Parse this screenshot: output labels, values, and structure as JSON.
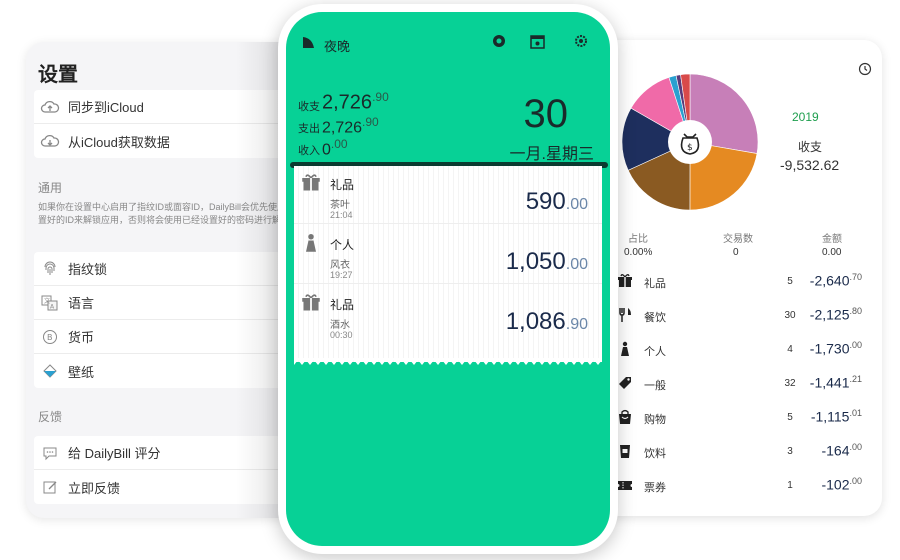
{
  "settings": {
    "title": "设置",
    "sync_items": [
      {
        "label": "同步到iCloud",
        "icon": "cloud-upload-icon"
      },
      {
        "label": "从iCloud获取数据",
        "icon": "cloud-download-icon"
      }
    ],
    "general_header": "通用",
    "general_note": "如果你在设置中心启用了指纹ID或面容ID，DailyBill会优先使用你设置好的ID来解锁应用，否则将会使用已经设置好的密码进行解锁",
    "general_items": [
      {
        "label": "指纹锁",
        "icon": "fingerprint-icon"
      },
      {
        "label": "语言",
        "icon": "language-icon"
      },
      {
        "label": "货币",
        "icon": "currency-icon"
      },
      {
        "label": "壁纸",
        "icon": "wallpaper-icon"
      }
    ],
    "feedback_header": "反馈",
    "feedback_items": [
      {
        "label": "给 DailyBill 评分",
        "icon": "rate-icon"
      },
      {
        "label": "立即反馈",
        "icon": "feedback-icon"
      }
    ]
  },
  "phone": {
    "mode_label": "夜晚",
    "summary": [
      {
        "label": "收支",
        "int": "2,726",
        "dec": ".90"
      },
      {
        "label": "支出",
        "int": "2,726",
        "dec": ".90"
      },
      {
        "label": "收入",
        "int": "0",
        "dec": ".00"
      }
    ],
    "day": "30",
    "date_label": "一月.星期三",
    "entries": [
      {
        "category": "礼品",
        "note": "茶叶",
        "time": "21:04",
        "amount_int": "590",
        "amount_dec": ".00",
        "icon": "gift-icon"
      },
      {
        "category": "个人",
        "note": "风衣",
        "time": "19:27",
        "amount_int": "1,050",
        "amount_dec": ".00",
        "icon": "person-icon"
      },
      {
        "category": "礼品",
        "note": "酒水",
        "time": "00:30",
        "amount_int": "1,086",
        "amount_dec": ".90",
        "icon": "gift-icon"
      }
    ]
  },
  "stats": {
    "year": "2019",
    "label": "收支",
    "value": "-9,532.62",
    "columns": [
      {
        "head": "占比",
        "value": "0.00%"
      },
      {
        "head": "交易数",
        "value": "0"
      },
      {
        "head": "金额",
        "value": "0.00"
      }
    ],
    "categories": [
      {
        "name": "礼品",
        "count": "5",
        "int": "-2,640",
        "dec": ".70",
        "icon": "gift-icon"
      },
      {
        "name": "餐饮",
        "count": "30",
        "int": "-2,125",
        "dec": ".80",
        "icon": "dining-icon"
      },
      {
        "name": "个人",
        "count": "4",
        "int": "-1,730",
        "dec": ".00",
        "icon": "person-icon"
      },
      {
        "name": "一般",
        "count": "32",
        "int": "-1,441",
        "dec": ".21",
        "icon": "tag-icon"
      },
      {
        "name": "购物",
        "count": "5",
        "int": "-1,115",
        "dec": ".01",
        "icon": "shopping-icon"
      },
      {
        "name": "饮料",
        "count": "3",
        "int": "-164",
        "dec": ".00",
        "icon": "drink-icon"
      },
      {
        "name": "票券",
        "count": "1",
        "int": "-102",
        "dec": ".00",
        "icon": "ticket-icon"
      }
    ],
    "pie_colors": [
      "#c77fb8",
      "#e58a22",
      "#8a5a22",
      "#1e2f5e",
      "#f06aa8",
      "#2aa0d0",
      "#5a3a7a",
      "#d84a4a"
    ],
    "pie_shares": [
      0.2771,
      0.2231,
      0.1815,
      0.1512,
      0.117,
      0.0172,
      0.0107,
      0.0222
    ]
  }
}
